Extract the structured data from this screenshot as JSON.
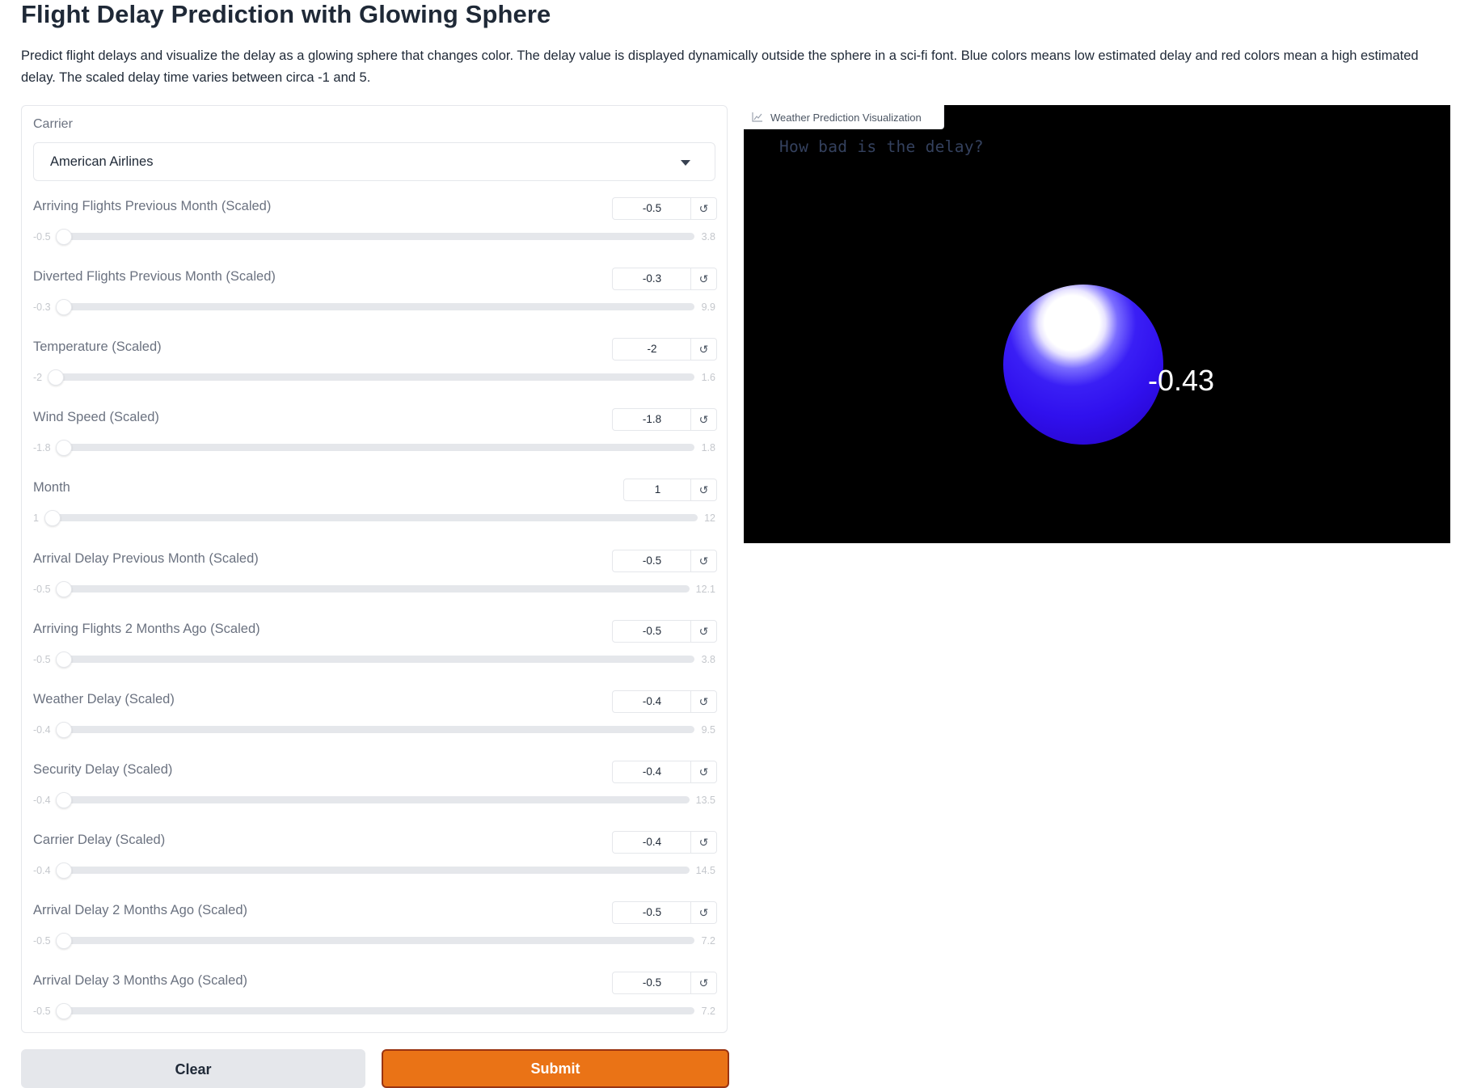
{
  "page": {
    "title": "Flight Delay Prediction with Glowing Sphere",
    "description": "Predict flight delays and visualize the delay as a glowing sphere that changes color. The delay value is displayed dynamically outside the sphere in a sci-fi font. Blue colors means low estimated delay and red colors mean a high estimated delay. The scaled delay time varies between circa -1 and 5."
  },
  "form": {
    "carrier": {
      "label": "Carrier",
      "value": "American Airlines"
    },
    "sliders": [
      {
        "label": "Arriving Flights Previous Month (Scaled)",
        "value": "-0.5",
        "min": "-0.5",
        "max": "3.8"
      },
      {
        "label": "Diverted Flights Previous Month (Scaled)",
        "value": "-0.3",
        "min": "-0.3",
        "max": "9.9"
      },
      {
        "label": "Temperature (Scaled)",
        "value": "-2",
        "min": "-2",
        "max": "1.6"
      },
      {
        "label": "Wind Speed (Scaled)",
        "value": "-1.8",
        "min": "-1.8",
        "max": "1.8"
      },
      {
        "label": "Month",
        "value": "1",
        "min": "1",
        "max": "12"
      },
      {
        "label": "Arrival Delay Previous Month (Scaled)",
        "value": "-0.5",
        "min": "-0.5",
        "max": "12.1"
      },
      {
        "label": "Arriving Flights 2 Months Ago (Scaled)",
        "value": "-0.5",
        "min": "-0.5",
        "max": "3.8"
      },
      {
        "label": "Weather Delay (Scaled)",
        "value": "-0.4",
        "min": "-0.4",
        "max": "9.5"
      },
      {
        "label": "Security Delay (Scaled)",
        "value": "-0.4",
        "min": "-0.4",
        "max": "13.5"
      },
      {
        "label": "Carrier Delay (Scaled)",
        "value": "-0.4",
        "min": "-0.4",
        "max": "14.5"
      },
      {
        "label": "Arrival Delay 2 Months Ago (Scaled)",
        "value": "-0.5",
        "min": "-0.5",
        "max": "7.2"
      },
      {
        "label": "Arrival Delay 3 Months Ago (Scaled)",
        "value": "-0.5",
        "min": "-0.5",
        "max": "7.2"
      }
    ],
    "reset_icon": "↺",
    "clear_label": "Clear",
    "submit_label": "Submit"
  },
  "visualization": {
    "tab_label": "Weather Prediction Visualization",
    "tab_icon": "chart-icon",
    "question": "How bad is the delay?",
    "delay_value": "-0.43",
    "sphere_color": "#3010ee"
  },
  "colors": {
    "accent": "#ea7316",
    "border": "#e5e7eb",
    "viz_background": "#000000"
  }
}
